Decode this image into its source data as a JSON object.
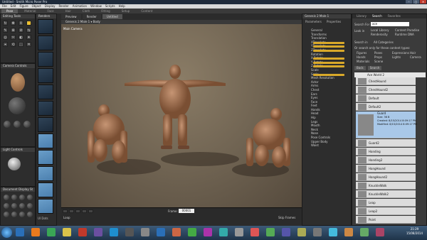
{
  "window": {
    "title": "Untitled - Smith Micro Poser Pro",
    "min": "–",
    "max": "□",
    "close": "✕"
  },
  "menubar": [
    "File",
    "Edit",
    "Figure",
    "Object",
    "Display",
    "Render",
    "Animation",
    "Window",
    "Scripts",
    "Help"
  ],
  "room_tabs": [
    "Pose",
    "Material",
    "Face",
    "Hair",
    "Cloth",
    "Fitting",
    "Setup",
    "Content"
  ],
  "doc_tabs": [
    "Preview",
    "Render",
    "Untitled"
  ],
  "panels": {
    "editing_tools": "Editing Tools",
    "renders": "Renders",
    "camera_controls": "Camera Controls",
    "light_controls": "Light Controls",
    "document_display": "Document Display St",
    "ui_dots": "UI Dots"
  },
  "viewport": {
    "selector": "Genesis 2 Male 1  ▾  Body",
    "camera": "Main Camera"
  },
  "timeline": {
    "frame_label": "Frame:",
    "frame_value": "00001",
    "loop": "Loop",
    "skip": "Skip Frames"
  },
  "params": {
    "header": "Genesis 2 Male 1",
    "tabs": [
      "Parameters",
      "Properties"
    ],
    "tree": [
      "General",
      "Transforms",
      "Translation",
      "XTranslate",
      "YTranslate",
      "ZTranslate",
      "Rotation",
      "X Rotate",
      "Y Rotate",
      "Z Rotate",
      "Scale",
      "Scale",
      "Mesh Resolution",
      "Actor",
      "Arms",
      "Chest",
      "Ears",
      "Eyes",
      "Face",
      "Feet",
      "Hands",
      "Head",
      "Hip",
      "Legs",
      "Mouth",
      "Neck",
      "Nose",
      "Pose Controls",
      "Upper Body",
      "Waist"
    ]
  },
  "library": {
    "tabs": [
      "Library",
      "Search",
      "Favorites"
    ],
    "search_for_label": "Search For",
    "search_value": "ace",
    "look_in_label": "Look in",
    "look_options": [
      "Local Library",
      "Content Paradise",
      "Renderosity",
      "Runtime DNA"
    ],
    "search_in_label": "Search in",
    "all_categories": "All Categories",
    "only_text": "Or search only for these content types:",
    "types": [
      "Figures",
      "Poses",
      "Expressions",
      "Hair",
      "Hands",
      "Props",
      "Lights",
      "Camera",
      "Materials",
      "Scene"
    ],
    "back": "Back",
    "search_btn": "Search",
    "all": "All",
    "header": "Ace World 2",
    "items": [
      "ChestHound",
      "ChestHound2",
      "Default",
      "Default2",
      "Guard",
      "Guard2",
      "Handing",
      "Handing2",
      "HangHound",
      "HangHound2",
      "KnuckleWalk",
      "KnuckleWalk2",
      "Leap",
      "Leap2",
      "Point"
    ],
    "detail": {
      "name": "Guard",
      "size": "Size: 36 B",
      "created": "Created: 8/15/2014 8:09:17 PM",
      "modified": "Modified: 8/15/2014 8:09:17 PM",
      "tag": "user"
    }
  },
  "tray": {
    "time": "21:29",
    "date": "15/08/2014"
  },
  "colors": {
    "accent": "#d9a92a",
    "highlight": "#a9c8e8"
  }
}
